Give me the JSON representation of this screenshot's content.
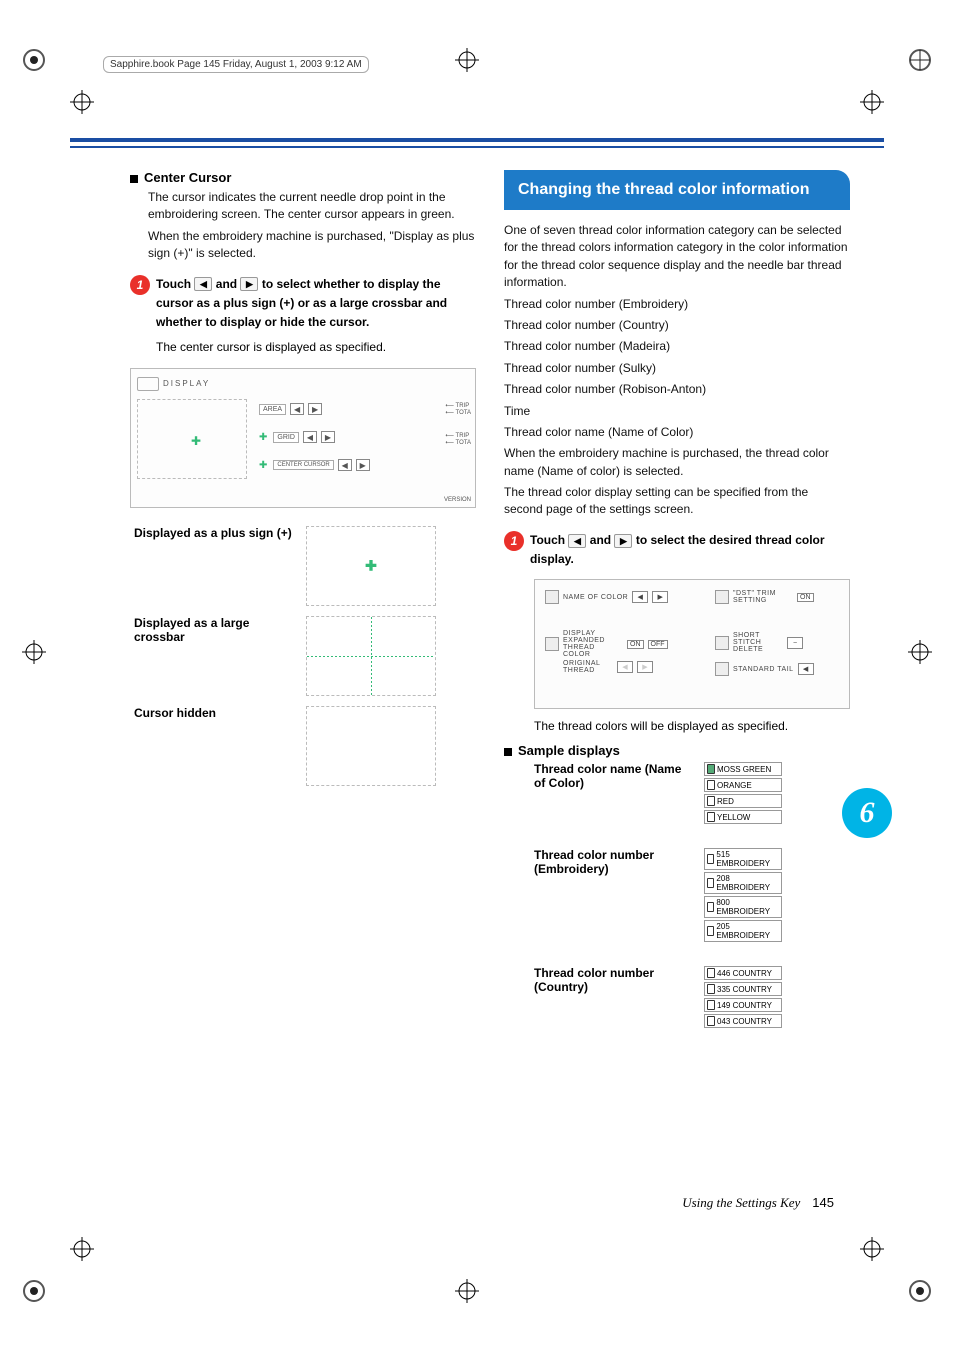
{
  "meta": {
    "header": "Sapphire.book  Page 145  Friday, August 1, 2003  9:12 AM"
  },
  "left": {
    "heading": "Center Cursor",
    "p1": "The cursor indicates the current needle drop point in the embroidering screen. The center cursor appears in green.",
    "p2": "When the embroidery machine is purchased, \"Display as plus sign (+)\" is selected.",
    "step1": {
      "pre": "Touch",
      "mid": "and",
      "post": "to select whether to display the cursor as a plus sign (+) or as a large crossbar and whether to display or hide the cursor."
    },
    "note": "The center cursor is displayed as specified.",
    "screenshot": {
      "display": "DISPLAY",
      "area": "AREA",
      "grid": "GRID",
      "center": "CENTER CURSOR",
      "r1a": "TRIP",
      "r1b": "TOTA",
      "r2a": "TRIP",
      "r2b": "TOTA",
      "version": "VERSION"
    },
    "table": {
      "r1": "Displayed as a plus sign (+)",
      "r2": "Displayed as a large crossbar",
      "r3": "Cursor hidden"
    }
  },
  "right": {
    "heading": "Changing the thread color information",
    "intro": "One of seven thread color information category can be selected for the thread colors information category in the color information for the thread color sequence display and the needle bar thread information.",
    "opts": [
      "Thread color number (Embroidery)",
      "Thread color number (Country)",
      "Thread color number (Madeira)",
      "Thread color number (Sulky)",
      "Thread color number (Robison-Anton)",
      "Time",
      "Thread color name (Name of Color)"
    ],
    "p2": "When the embroidery machine is purchased, the thread color name (Name of color) is selected.",
    "p3": "The thread color display setting can be specified from the second page of the settings screen.",
    "step1": {
      "pre": "Touch",
      "mid": "and",
      "post": "to select the desired thread color display."
    },
    "screenshot": {
      "name_of_color": "NAME OF COLOR",
      "disp_exp": "DISPLAY EXPANDED THREAD COLOR",
      "on": "ON",
      "off": "OFF",
      "original": "ORIGINAL THREAD",
      "dst": "\"DST\" TRIM SETTING",
      "on2": "ON",
      "short_stitch": "SHORT STITCH DELETE",
      "std_tail": "STANDARD TAIL"
    },
    "followup": "The thread colors will be displayed as specified.",
    "samples_h": "Sample displays",
    "samples": {
      "s1": {
        "label": "Thread color name (Name of Color)",
        "items": [
          "MOSS GREEN",
          "ORANGE",
          "RED",
          "YELLOW"
        ]
      },
      "s2": {
        "label": "Thread color number (Embroidery)",
        "items": [
          "515 EMBROIDERY",
          "208 EMBROIDERY",
          "800 EMBROIDERY",
          "205 EMBROIDERY"
        ]
      },
      "s3": {
        "label": "Thread color number (Country)",
        "items": [
          "446 COUNTRY",
          "335 COUNTRY",
          "149 COUNTRY",
          "043 COUNTRY"
        ]
      }
    }
  },
  "chapter": "6",
  "footer": {
    "section": "Using the Settings Key",
    "page": "145"
  }
}
